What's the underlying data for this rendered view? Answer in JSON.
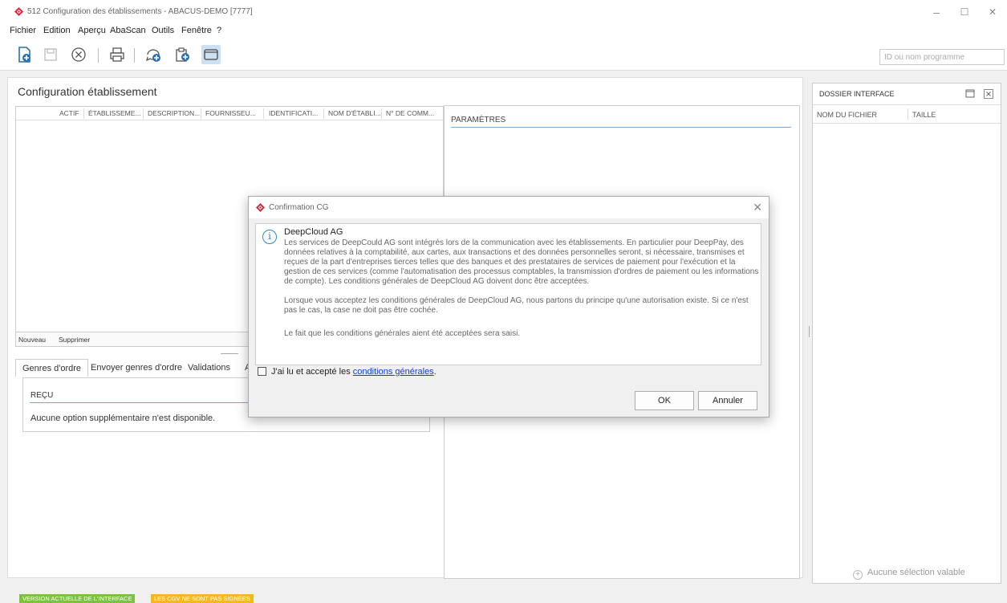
{
  "window": {
    "title": "512 Configuration des établissements - ABACUS-DEMO [7777]",
    "minimize_glyph": "–",
    "maximize_glyph": "☐",
    "close_glyph": "✕"
  },
  "menu": [
    "Fichier",
    "Edition",
    "Aperçu",
    "AbaScan",
    "Outils",
    "Fenêtre",
    "?"
  ],
  "toolbar": {
    "icons": [
      "new-document-icon",
      "save-icon",
      "cancel-icon",
      "print-icon",
      "add-comment-icon",
      "clipboard-add-icon",
      "window-icon"
    ],
    "program_placeholder": "ID ou nom programme"
  },
  "main": {
    "title": "Configuration établissement",
    "columns": [
      "ACTIF",
      "ÉTABLISSEME...",
      "DESCRIPTION...",
      "FOURNISSEU...",
      "IDENTIFICATI...",
      "NOM D'ÉTABLI...",
      "N° DE COMM..."
    ],
    "footer": {
      "new": "Nouveau",
      "delete": "Supprimer"
    },
    "tabs": [
      "Genres d'ordre",
      "Envoyer genres d'ordre",
      "Validations",
      "A"
    ],
    "tab_panel": {
      "label": "REÇU",
      "message": "Aucune option supplémentaire n'est disponible."
    },
    "params_label": "PARAMÈTRES"
  },
  "dossier": {
    "title": "DOSSIER INTERFACE",
    "columns": [
      "NOM DU FICHIER",
      "TAILLE"
    ],
    "empty": "Aucune sélection valable",
    "empty_glyph": "+"
  },
  "status": {
    "badge1": {
      "text": "VERSION ACTUELLE DE L'INTERFACE",
      "color": "#7cc142"
    },
    "badge2": {
      "text": "LES CGV NE SONT PAS SIGNÉES",
      "color": "#f4b823"
    }
  },
  "dialog": {
    "title": "Confirmation CG",
    "close_glyph": "✕",
    "info_glyph": "i",
    "heading": "DeepCloud AG",
    "paragraph1": "Les services de DeepCould AG sont intégrés lors de la communication avec les établissements. En particulier pour DeepPay, des données relatives à la comptabilité, aux cartes, aux transactions et des données personnelles seront, si nécessaire, transmises et reçues de la part d'entreprises tierces telles que des banques et des prestataires de services de paiement pour l'exécution et la gestion de ces services (comme l'automatisation des processus comptables, la transmission d'ordres de paiement ou les informations de compte). Les conditions générales de DeepCloud AG doivent donc être acceptées.",
    "paragraph2": "Lorsque vous acceptez les conditions générales de DeepCloud AG, nous partons du principe qu'une autorisation existe. Si ce n'est pas le cas, la case ne doit pas être cochée.",
    "paragraph3": "Le fait que les conditions générales aient été acceptées sera saisi.",
    "checkbox_label": "J'ai lu et accepté les ",
    "checkbox_link": "conditions générales",
    "checkbox_suffix": ".",
    "ok": "OK",
    "cancel": "Annuler"
  },
  "colors": {
    "accent": "#d7263d",
    "link": "#0b3fc4",
    "info": "#2a8bbf"
  }
}
